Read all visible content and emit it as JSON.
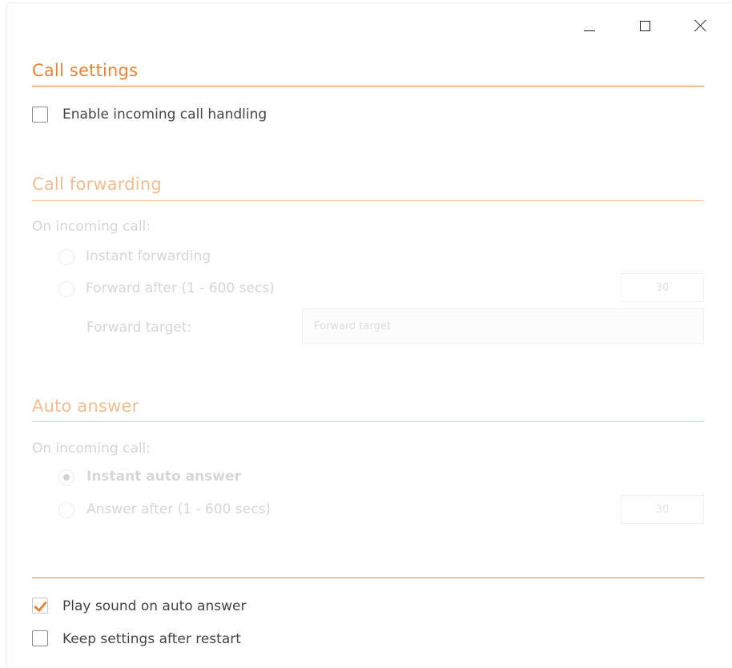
{
  "titlebar": {
    "minimize_icon": "minimize-icon",
    "maximize_icon": "maximize-icon",
    "close_icon": "close-icon"
  },
  "call_settings": {
    "title": "Call settings",
    "enable_incoming_label": "Enable incoming call handling",
    "enable_incoming_checked": false
  },
  "call_forwarding": {
    "title": "Call forwarding",
    "on_incoming_label": "On incoming call:",
    "instant_label": "Instant forwarding",
    "forward_after_label": "Forward after (1 - 600 secs)",
    "forward_after_value": "30",
    "forward_target_label": "Forward target:",
    "forward_target_placeholder": "Forward target"
  },
  "auto_answer": {
    "title": "Auto answer",
    "on_incoming_label": "On incoming call:",
    "instant_label": "Instant auto answer",
    "answer_after_label": "Answer after (1 - 600 secs)",
    "answer_after_value": "30"
  },
  "footer": {
    "play_sound_label": "Play sound on auto answer",
    "play_sound_checked": true,
    "keep_settings_label": "Keep settings after restart",
    "keep_settings_checked": false
  },
  "colors": {
    "accent": "#e8843a",
    "accent_dim": "#f3bd94",
    "text": "#444444",
    "disabled_text": "#d6d6d6"
  }
}
